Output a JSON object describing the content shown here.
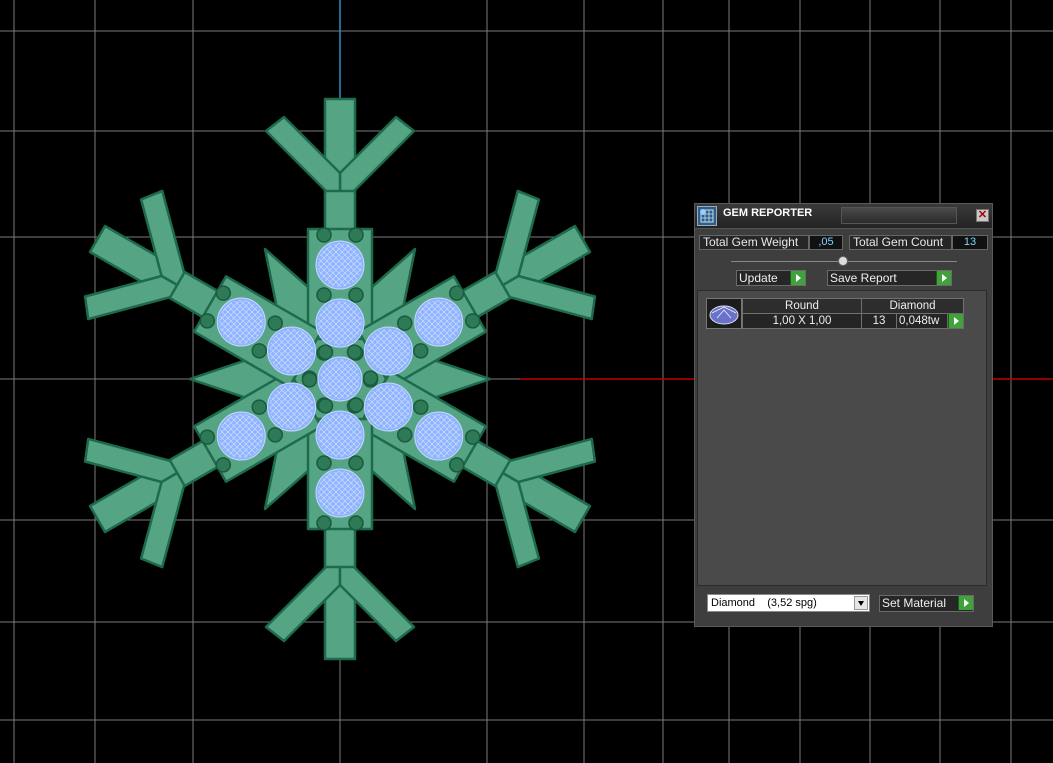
{
  "panel": {
    "title": "GEM REPORTER",
    "close_glyph": "✕",
    "total_weight_label": "Total Gem Weight",
    "total_weight_value": ",05",
    "total_count_label": "Total Gem Count",
    "total_count_value": "13",
    "update_label": "Update",
    "save_report_label": "Save Report",
    "table": {
      "headers": [
        "Round",
        "Diamond"
      ],
      "row": {
        "size": "1,00 X 1,00",
        "count": "13",
        "weight": "0,048tw"
      }
    },
    "material_selected": "Diamond    (3,52 spg)",
    "set_material_label": "Set Material"
  },
  "icons": {
    "panel_icon": "gem-reporter-icon",
    "close": "close-icon",
    "arrow": "play-arrow-icon",
    "dropdown": "chevron-down-icon",
    "gem": "round-gem-icon"
  },
  "colors": {
    "model": "#55a585",
    "model_edge": "#1e6a4c",
    "gem": "#8fb3ff",
    "grid": "#7a7a7a",
    "axis_x": "#c00000",
    "axis_y": "#2e8ec8",
    "accent_button": "#3fa23a",
    "value_text": "#7fd6ff"
  }
}
